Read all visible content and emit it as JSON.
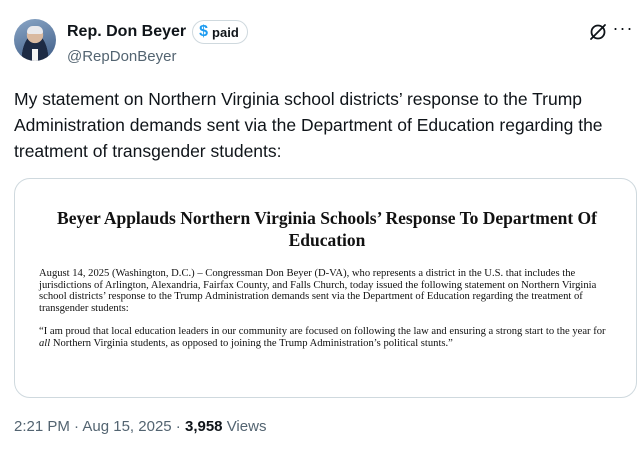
{
  "author": {
    "name": "Rep. Don Beyer",
    "badge_label": "paid",
    "badge_symbol": "$",
    "handle": "@RepDonBeyer"
  },
  "icons": {
    "grok": "grok-icon",
    "more": "more-icon"
  },
  "tweet": {
    "text": "My statement on Northern Virginia school districts’ response to the Trump Administration demands sent via the Department of Education regarding the treatment of transgender students:"
  },
  "card": {
    "title": "Beyer Applauds Northern Virginia Schools’ Response To Department Of Education",
    "paragraph": "August 14, 2025 (Washington, D.C.) – Congressman Don Beyer (D-VA), who represents a district in the U.S. that includes the jurisdictions of Arlington, Alexandria, Fairfax County, and Falls Church, today issued the following statement on Northern Virginia school districts’ response to the Trump Administration demands sent via the Department of Education regarding the treatment of transgender students:",
    "quote_before": "“I am proud that local education leaders in our community are focused on following the law and ensuring a strong start to the year for ",
    "quote_emphasis": "all",
    "quote_after": " Northern Virginia students, as opposed to joining the Trump Administration’s political stunts.”"
  },
  "meta": {
    "time": "2:21 PM",
    "separator": " · ",
    "date": "Aug 15, 2025",
    "views_count": "3,958",
    "views_label": " Views"
  },
  "colors": {
    "text_primary": "#0f1419",
    "text_secondary": "#536471",
    "accent": "#1d9bf0",
    "border": "#cfd9de"
  }
}
